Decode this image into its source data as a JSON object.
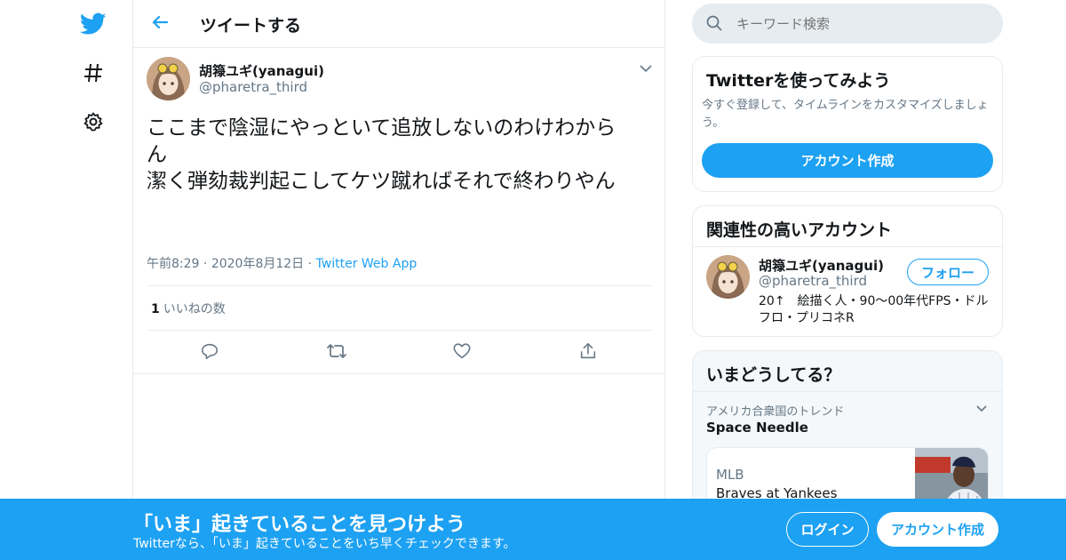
{
  "header": {
    "title": "ツイートする"
  },
  "tweet": {
    "author_name": "胡簶ユギ(yanagui)",
    "author_handle": "@pharetra_third",
    "text": "ここまで陰湿にやっといて追放しないのわけわから\nん\n潔く弾劾裁判起こしてケツ蹴ればそれで終わりやん",
    "time": "午前8:29",
    "date": "2020年8月12日",
    "app": "Twitter Web App",
    "like_count": "1",
    "like_label": "いいねの数"
  },
  "search": {
    "placeholder": "キーワード検索"
  },
  "signup_card": {
    "title": "Twitterを使ってみよう",
    "description": "今すぐ登録して、タイムラインをカスタマイズしましょう。",
    "button": "アカウント作成"
  },
  "related_card": {
    "title": "関連性の高いアカウント",
    "name": "胡簶ユギ(yanagui)",
    "handle": "@pharetra_third",
    "bio": "20↑　絵描く人・90～00年代FPS・ドルフロ・プリコネR",
    "follow": "フォロー"
  },
  "trends_card": {
    "title": "いまどうしてる？",
    "trend_context": "アメリカ合衆国のトレンド",
    "trend_name": "Space Needle",
    "event_category": "MLB",
    "event_title": "Braves at Yankees"
  },
  "bottom_bar": {
    "title": "「いま」起きていることを見つけよう",
    "subtitle": "Twitterなら、「いま」起きていることをいち早くチェックできます。",
    "login": "ログイン",
    "signup": "アカウント作成"
  },
  "colors": {
    "accent": "#1da1f2",
    "muted": "#657786",
    "border": "#e6ecf0"
  }
}
